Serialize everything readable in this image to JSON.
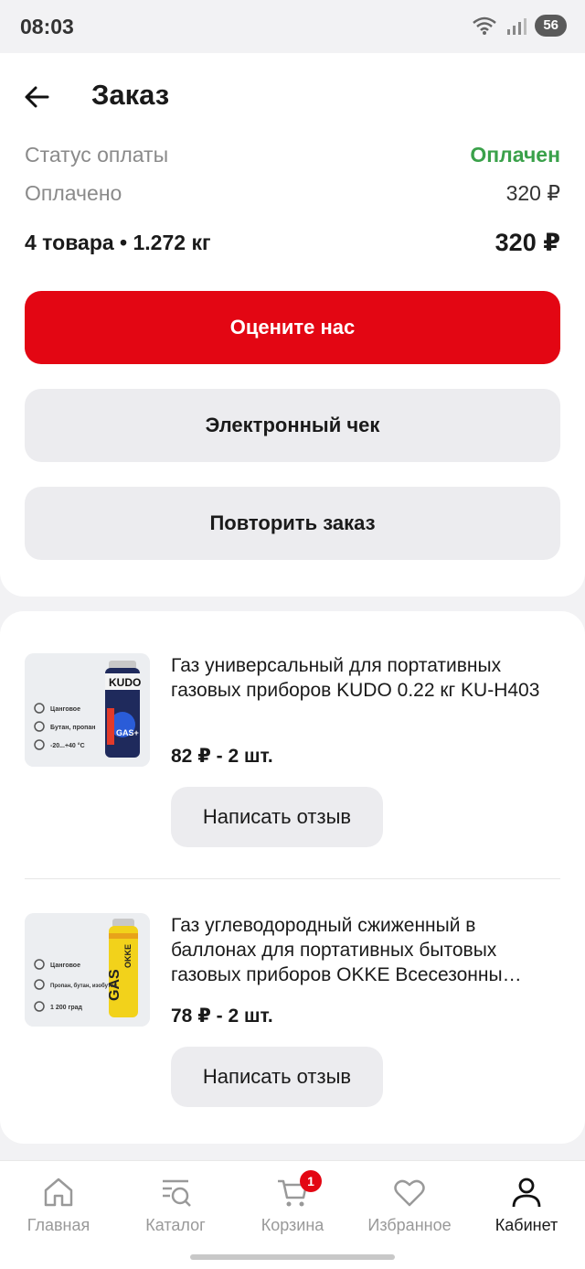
{
  "status_bar": {
    "time": "08:03",
    "battery": "56",
    "network_badge": "5"
  },
  "header": {
    "title": "Заказ"
  },
  "summary": {
    "status_label": "Статус оплаты",
    "status_value": "Оплачен",
    "paid_label": "Оплачено",
    "paid_value": "320 ₽",
    "items_label": "4 товара • 1.272 кг",
    "total_value": "320 ₽"
  },
  "actions": {
    "rate": "Оцените нас",
    "receipt": "Электронный чек",
    "repeat": "Повторить заказ"
  },
  "items": [
    {
      "name": "Газ универсальный для портативных газовых приборов KUDO 0.22 кг KU-H403",
      "price": "82 ₽ - 2 шт.",
      "review": "Написать отзыв",
      "thumb": {
        "brand": "KUDO",
        "tag": "GAS+",
        "lines": [
          "Цанговое",
          "Бутан, пропан",
          "-20...+40 °C"
        ]
      }
    },
    {
      "name": "Газ углеводородный сжиженный в баллонах для портативных бытовых газовых приборов OKKE Всесезонны…",
      "price": "78 ₽ - 2 шт.",
      "review": "Написать отзыв",
      "thumb": {
        "brand": "OKKE",
        "tag": "GAS",
        "lines": [
          "Цанговое",
          "Пропан, бутан, изобутан",
          "1 200 град"
        ]
      }
    }
  ],
  "tabbar": {
    "home": "Главная",
    "catalog": "Каталог",
    "cart": "Корзина",
    "cart_badge": "1",
    "favorites": "Избранное",
    "cabinet": "Кабинет"
  },
  "colors": {
    "accent": "#e30613",
    "success": "#3aa14a",
    "button_gray": "#ececef"
  }
}
